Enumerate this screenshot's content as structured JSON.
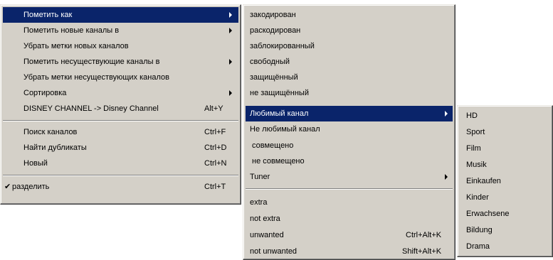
{
  "menu1": {
    "items": [
      {
        "label": "Пометить как",
        "submenu": true
      },
      {
        "label": "Пометить новые каналы в",
        "submenu": true
      },
      {
        "label": "Убрать метки новых каналов"
      },
      {
        "label": "Пометить несуществующие каналы в",
        "submenu": true
      },
      {
        "label": "Убрать метки несуществующих каналов"
      },
      {
        "label": "Сортировка",
        "submenu": true
      },
      {
        "label": "DISNEY CHANNEL -> Disney Channel",
        "shortcut": "Alt+Y"
      },
      {
        "label": "Поиск каналов",
        "shortcut": "Ctrl+F"
      },
      {
        "label": "Найти дубликаты",
        "shortcut": "Ctrl+D"
      },
      {
        "label": "Новый",
        "shortcut": "Ctrl+N"
      },
      {
        "label": "разделить",
        "shortcut": "Ctrl+T",
        "check": "✔"
      }
    ]
  },
  "menu2": {
    "items": [
      {
        "label": "закодирован"
      },
      {
        "label": "раскодирован"
      },
      {
        "label": "заблокированный"
      },
      {
        "label": "свободный"
      },
      {
        "label": "защищённый"
      },
      {
        "label": "не защищённый"
      },
      {
        "label": "Любимый канал",
        "submenu": true
      },
      {
        "label": "Не любимый канал"
      },
      {
        "label": "совмещено"
      },
      {
        "label": "не совмещено"
      },
      {
        "label": "Tuner",
        "submenu": true
      },
      {
        "label": "extra"
      },
      {
        "label": "not extra"
      },
      {
        "label": "unwanted",
        "shortcut": "Ctrl+Alt+K"
      },
      {
        "label": "not unwanted",
        "shortcut": "Shift+Alt+K"
      }
    ]
  },
  "menu3": {
    "items": [
      {
        "label": "HD"
      },
      {
        "label": "Sport"
      },
      {
        "label": "Film"
      },
      {
        "label": "Musik"
      },
      {
        "label": "Einkaufen"
      },
      {
        "label": "Kinder"
      },
      {
        "label": "Erwachsene"
      },
      {
        "label": "Bildung"
      },
      {
        "label": "Drama"
      }
    ]
  },
  "colors": {
    "menu_bg": "#d4d0c8",
    "highlight": "#0a246a",
    "highlight_text": "#ffffff"
  }
}
